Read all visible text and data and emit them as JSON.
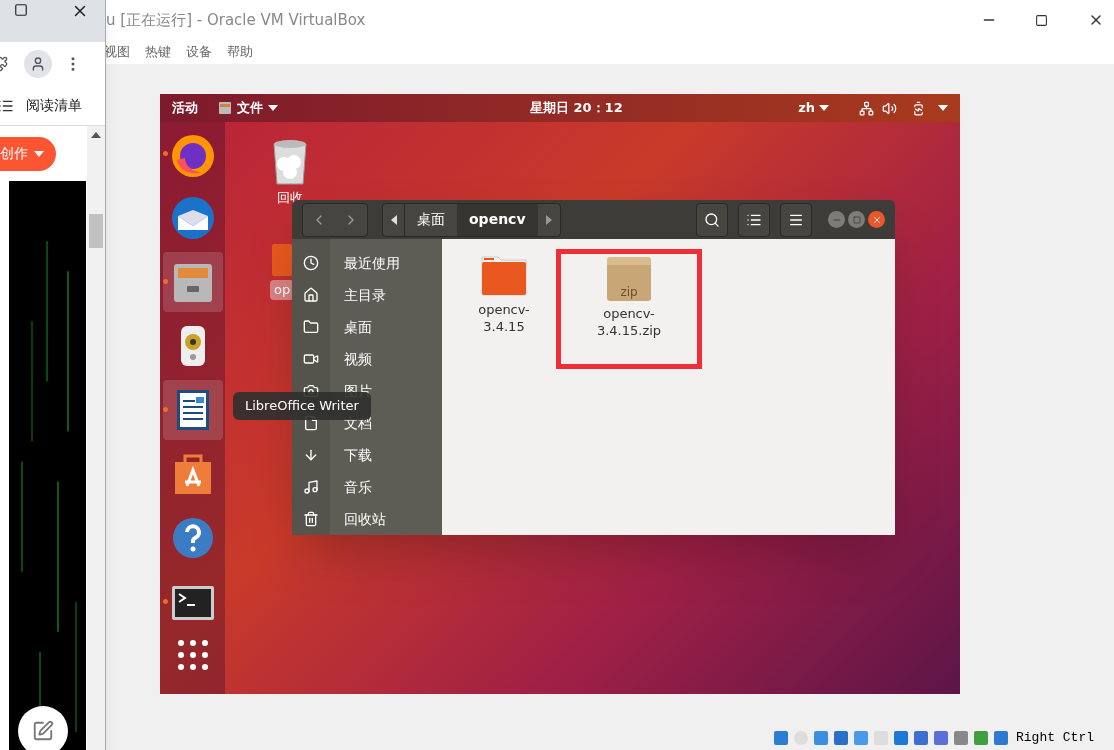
{
  "vbox": {
    "title": "u [正在运行] - Oracle VM VirtualBox",
    "menu": [
      "视图",
      "热键",
      "设备",
      "帮助"
    ],
    "host_key": "Right Ctrl"
  },
  "guest": {
    "top_bar": {
      "activities": "活动",
      "app_menu": "文件",
      "clock": "星期日 20：12",
      "input_method": "zh"
    },
    "dock": [
      {
        "kind": "firefox",
        "running": true,
        "highlighted": false
      },
      {
        "kind": "thunderbird",
        "running": false,
        "highlighted": false
      },
      {
        "kind": "files",
        "running": true,
        "highlighted": true
      },
      {
        "kind": "speaker",
        "running": false,
        "highlighted": false
      },
      {
        "kind": "writer",
        "running": true,
        "highlighted": true
      },
      {
        "kind": "store",
        "running": false,
        "highlighted": false
      },
      {
        "kind": "help",
        "running": false,
        "highlighted": false
      },
      {
        "kind": "terminal",
        "running": true,
        "highlighted": false
      }
    ],
    "desktop_icons": [
      {
        "kind": "trash",
        "label": "回收",
        "selected": false
      },
      {
        "kind": "folder",
        "label": "op",
        "selected": true
      }
    ],
    "tooltip": "LibreOffice Writer",
    "files": {
      "path": [
        {
          "label": "桌面",
          "selected": false
        },
        {
          "label": "opencv",
          "selected": true
        }
      ],
      "sidebar": [
        {
          "kind": "recent",
          "label": "最近使用"
        },
        {
          "kind": "home",
          "label": "主目录"
        },
        {
          "kind": "desktop",
          "label": "桌面"
        },
        {
          "kind": "videos",
          "label": "视频"
        },
        {
          "kind": "pictures",
          "label": "图片"
        },
        {
          "kind": "documents",
          "label": "文档"
        },
        {
          "kind": "downloads",
          "label": "下载"
        },
        {
          "kind": "music",
          "label": "音乐"
        },
        {
          "kind": "trash",
          "label": "回收站"
        }
      ],
      "items": [
        {
          "kind": "folder",
          "name": "opencv-3.4.15",
          "highlighted": false
        },
        {
          "kind": "zip",
          "name": "opencv-3.4.15.zip",
          "badge": "zip",
          "highlighted": true
        }
      ]
    }
  },
  "browser": {
    "reading_list": "阅读清单",
    "create_button": "创作"
  }
}
